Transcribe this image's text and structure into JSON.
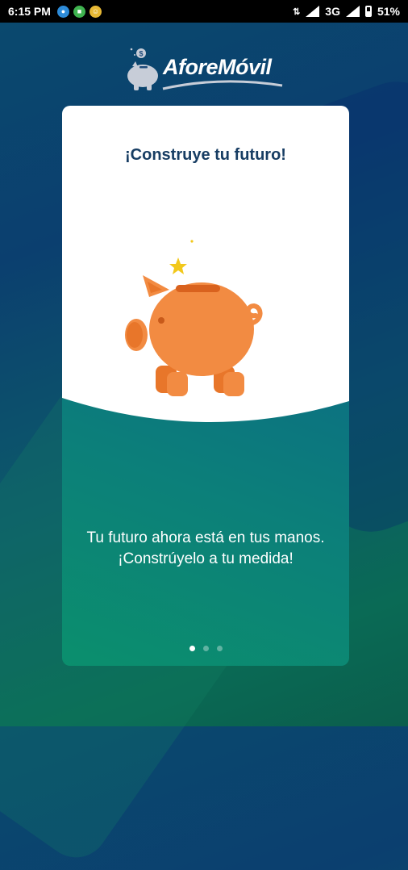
{
  "status_bar": {
    "time": "6:15 PM",
    "icons": [
      "shield-icon",
      "android-icon",
      "emoji-icon"
    ],
    "network": "3G",
    "battery": "51%",
    "signal_icons": [
      "signal-icon",
      "signal-icon"
    ]
  },
  "app": {
    "logo_text": "AforeMóvil",
    "logo_icon": "piggy-bank-icon"
  },
  "onboarding": {
    "title": "¡Construye tu futuro!",
    "description": "Tu futuro ahora está en tus manos. ¡Constrúyelo a tu medida!",
    "illustration": "piggy-bank-icon",
    "pages": 3,
    "current_page": 1
  },
  "colors": {
    "title": "#173d63",
    "piggy": "#f28b42",
    "star": "#f2c81b"
  }
}
